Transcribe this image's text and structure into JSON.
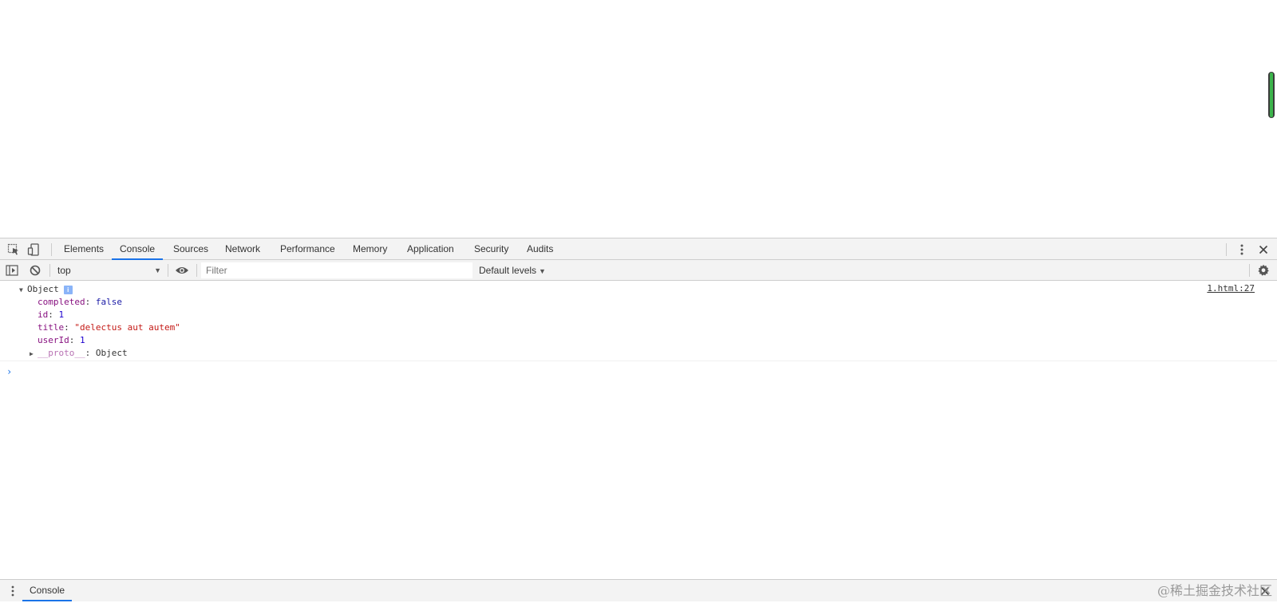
{
  "devtools": {
    "tabs": [
      "Elements",
      "Console",
      "Sources",
      "Network",
      "Performance",
      "Memory",
      "Application",
      "Security",
      "Audits"
    ],
    "active_tab": "Console",
    "icons": {
      "inspect": "cursor-select-icon",
      "device": "device-toggle-icon",
      "more": "more-vertical-icon",
      "close": "close-icon"
    }
  },
  "console_toolbar": {
    "context": "top",
    "filter_placeholder": "Filter",
    "levels": "Default levels"
  },
  "log": {
    "source": "1.html:27",
    "object_label": "Object",
    "info_badge": "i",
    "properties": [
      {
        "key": "completed",
        "sep": ": ",
        "value": "false",
        "type": "bool"
      },
      {
        "key": "id",
        "sep": ": ",
        "value": "1",
        "type": "num"
      },
      {
        "key": "title",
        "sep": ": ",
        "value": "\"delectus aut autem\"",
        "type": "str"
      },
      {
        "key": "userId",
        "sep": ": ",
        "value": "1",
        "type": "num"
      }
    ],
    "proto_key": "__proto__",
    "proto_sep": ": ",
    "proto_value": "Object",
    "prompt": "›"
  },
  "drawer": {
    "tab": "Console",
    "watermark": "@稀土掘金技术社区"
  },
  "colors": {
    "accent": "#1a73e8",
    "key": "#881280",
    "string": "#c41a16",
    "number": "#1c00cf",
    "scrollbar_green": "#3cb44b"
  }
}
